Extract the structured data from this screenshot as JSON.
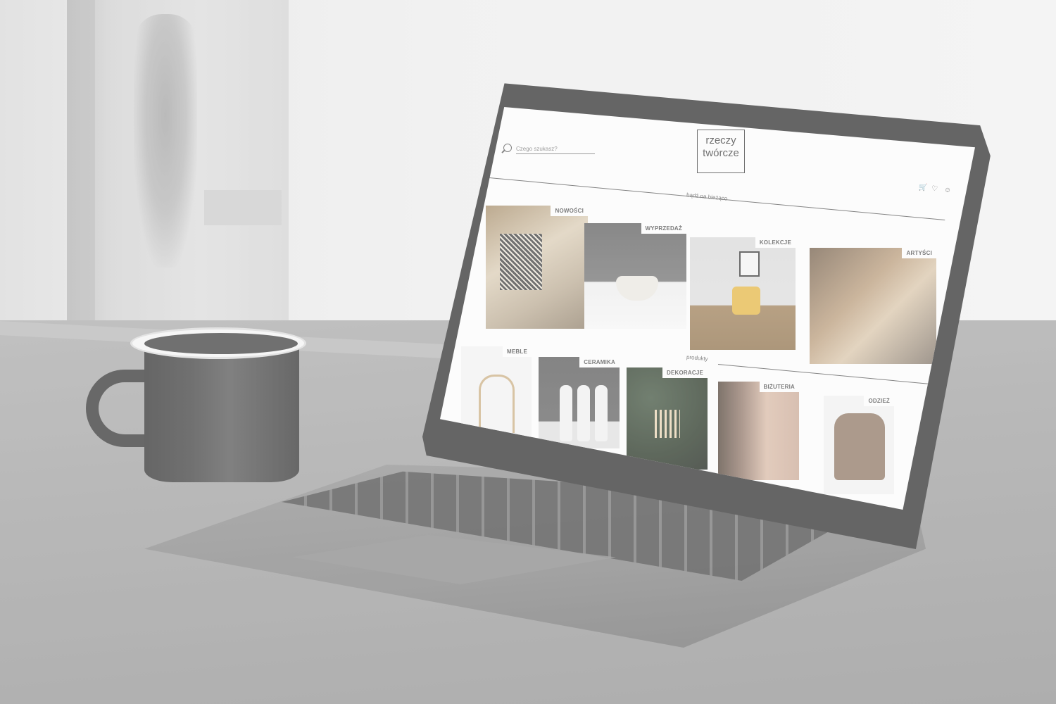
{
  "site": {
    "search": {
      "placeholder": "Czego szukasz?"
    },
    "logo": {
      "line1": "rzeczy",
      "line2": "twórcze"
    },
    "tagline": "bądź na bieżąco",
    "section_products": "produkty",
    "header_icons": [
      "cart-icon",
      "heart-icon",
      "user-icon"
    ]
  },
  "featured": [
    {
      "label": "NOWOŚCI"
    },
    {
      "label": "WYPRZEDAŻ"
    },
    {
      "label": "KOLEKCJE"
    },
    {
      "label": "ARTYŚCI"
    }
  ],
  "categories": [
    {
      "label": "MEBLE"
    },
    {
      "label": "CERAMIKA"
    },
    {
      "label": "DEKORACJE"
    },
    {
      "label": "BIŻUTERIA"
    },
    {
      "label": "ODZIEŻ"
    }
  ],
  "colors": {
    "text": "#4a4a4a",
    "background": "#fbfbfb",
    "accent": "#3a3a3a"
  }
}
